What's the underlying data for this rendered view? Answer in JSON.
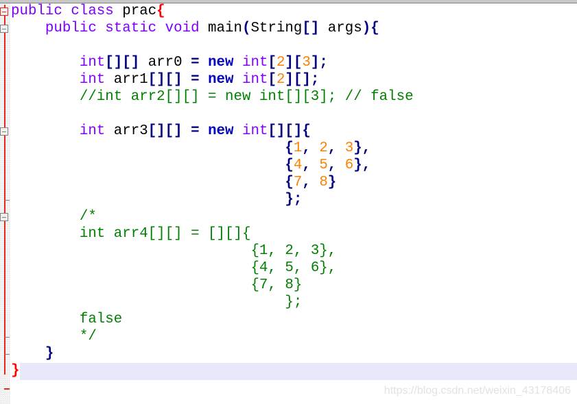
{
  "editor": {
    "language": "java",
    "current_line": 22,
    "colors": {
      "keyword": "#8000ff",
      "keyword_bold": "#0000c0",
      "operator": "#000080",
      "number": "#ff8000",
      "comment": "#008000",
      "brace_match": "#ff0000",
      "current_line_bg": "#e8e8fa",
      "fold_marker": "#e8261b"
    },
    "lines": [
      {
        "tokens": [
          {
            "t": "public class ",
            "c": "kw"
          },
          {
            "t": "prac",
            "c": "tx"
          },
          {
            "t": "{",
            "c": "brace-red"
          }
        ]
      },
      {
        "tokens": [
          {
            "t": "    ",
            "c": "tx"
          },
          {
            "t": "public static void ",
            "c": "kw"
          },
          {
            "t": "main",
            "c": "tx"
          },
          {
            "t": "(",
            "c": "op"
          },
          {
            "t": "String",
            "c": "tx"
          },
          {
            "t": "[]",
            "c": "op"
          },
          {
            "t": " args",
            "c": "tx"
          },
          {
            "t": "){",
            "c": "op"
          }
        ]
      },
      {
        "tokens": []
      },
      {
        "tokens": [
          {
            "t": "        ",
            "c": "tx"
          },
          {
            "t": "int",
            "c": "kw"
          },
          {
            "t": "[][]",
            "c": "op"
          },
          {
            "t": " arr0 ",
            "c": "tx"
          },
          {
            "t": "=",
            "c": "op"
          },
          {
            "t": " ",
            "c": "tx"
          },
          {
            "t": "new",
            "c": "kw2"
          },
          {
            "t": " int",
            "c": "kw"
          },
          {
            "t": "[",
            "c": "op"
          },
          {
            "t": "2",
            "c": "num"
          },
          {
            "t": "][",
            "c": "op"
          },
          {
            "t": "3",
            "c": "num"
          },
          {
            "t": "];",
            "c": "op"
          }
        ]
      },
      {
        "tokens": [
          {
            "t": "        ",
            "c": "tx"
          },
          {
            "t": "int",
            "c": "kw"
          },
          {
            "t": " arr1",
            "c": "tx"
          },
          {
            "t": "[][]",
            "c": "op"
          },
          {
            "t": " ",
            "c": "tx"
          },
          {
            "t": "=",
            "c": "op"
          },
          {
            "t": " ",
            "c": "tx"
          },
          {
            "t": "new",
            "c": "kw2"
          },
          {
            "t": " int",
            "c": "kw"
          },
          {
            "t": "[",
            "c": "op"
          },
          {
            "t": "2",
            "c": "num"
          },
          {
            "t": "][];",
            "c": "op"
          }
        ]
      },
      {
        "tokens": [
          {
            "t": "        ",
            "c": "tx"
          },
          {
            "t": "//int arr2[][] = new int[][3]; // false",
            "c": "cm"
          }
        ]
      },
      {
        "tokens": []
      },
      {
        "tokens": [
          {
            "t": "        ",
            "c": "tx"
          },
          {
            "t": "int",
            "c": "kw"
          },
          {
            "t": " arr3",
            "c": "tx"
          },
          {
            "t": "[][]",
            "c": "op"
          },
          {
            "t": " ",
            "c": "tx"
          },
          {
            "t": "=",
            "c": "op"
          },
          {
            "t": " ",
            "c": "tx"
          },
          {
            "t": "new",
            "c": "kw2"
          },
          {
            "t": " int",
            "c": "kw"
          },
          {
            "t": "[][]{",
            "c": "op"
          }
        ]
      },
      {
        "tokens": [
          {
            "t": "                                ",
            "c": "tx"
          },
          {
            "t": "{",
            "c": "op"
          },
          {
            "t": "1",
            "c": "num"
          },
          {
            "t": ", ",
            "c": "op"
          },
          {
            "t": "2",
            "c": "num"
          },
          {
            "t": ", ",
            "c": "op"
          },
          {
            "t": "3",
            "c": "num"
          },
          {
            "t": "},",
            "c": "op"
          }
        ]
      },
      {
        "tokens": [
          {
            "t": "                                ",
            "c": "tx"
          },
          {
            "t": "{",
            "c": "op"
          },
          {
            "t": "4",
            "c": "num"
          },
          {
            "t": ", ",
            "c": "op"
          },
          {
            "t": "5",
            "c": "num"
          },
          {
            "t": ", ",
            "c": "op"
          },
          {
            "t": "6",
            "c": "num"
          },
          {
            "t": "},",
            "c": "op"
          }
        ]
      },
      {
        "tokens": [
          {
            "t": "                                ",
            "c": "tx"
          },
          {
            "t": "{",
            "c": "op"
          },
          {
            "t": "7",
            "c": "num"
          },
          {
            "t": ", ",
            "c": "op"
          },
          {
            "t": "8",
            "c": "num"
          },
          {
            "t": "}",
            "c": "op"
          }
        ]
      },
      {
        "tokens": [
          {
            "t": "                                ",
            "c": "tx"
          },
          {
            "t": "};",
            "c": "op"
          }
        ]
      },
      {
        "tokens": [
          {
            "t": "        ",
            "c": "tx"
          },
          {
            "t": "/*",
            "c": "cm"
          }
        ]
      },
      {
        "tokens": [
          {
            "t": "        ",
            "c": "tx"
          },
          {
            "t": "int arr4[][] = [][]{",
            "c": "cm"
          }
        ]
      },
      {
        "tokens": [
          {
            "t": "                            ",
            "c": "tx"
          },
          {
            "t": "{1, 2, 3},",
            "c": "cm"
          }
        ]
      },
      {
        "tokens": [
          {
            "t": "                            ",
            "c": "tx"
          },
          {
            "t": "{4, 5, 6},",
            "c": "cm"
          }
        ]
      },
      {
        "tokens": [
          {
            "t": "                            ",
            "c": "tx"
          },
          {
            "t": "{7, 8}",
            "c": "cm"
          }
        ]
      },
      {
        "tokens": [
          {
            "t": "                                ",
            "c": "tx"
          },
          {
            "t": "};",
            "c": "cm"
          }
        ]
      },
      {
        "tokens": [
          {
            "t": "        ",
            "c": "tx"
          },
          {
            "t": "false",
            "c": "cm"
          }
        ]
      },
      {
        "tokens": [
          {
            "t": "        ",
            "c": "tx"
          },
          {
            "t": "*/",
            "c": "cm"
          }
        ]
      },
      {
        "tokens": [
          {
            "t": "    ",
            "c": "tx"
          },
          {
            "t": "}",
            "c": "op"
          }
        ]
      },
      {
        "tokens": [
          {
            "t": "}",
            "c": "brace-red"
          }
        ]
      }
    ]
  },
  "watermark": "https://blog.csdn.net/weixin_43178406"
}
